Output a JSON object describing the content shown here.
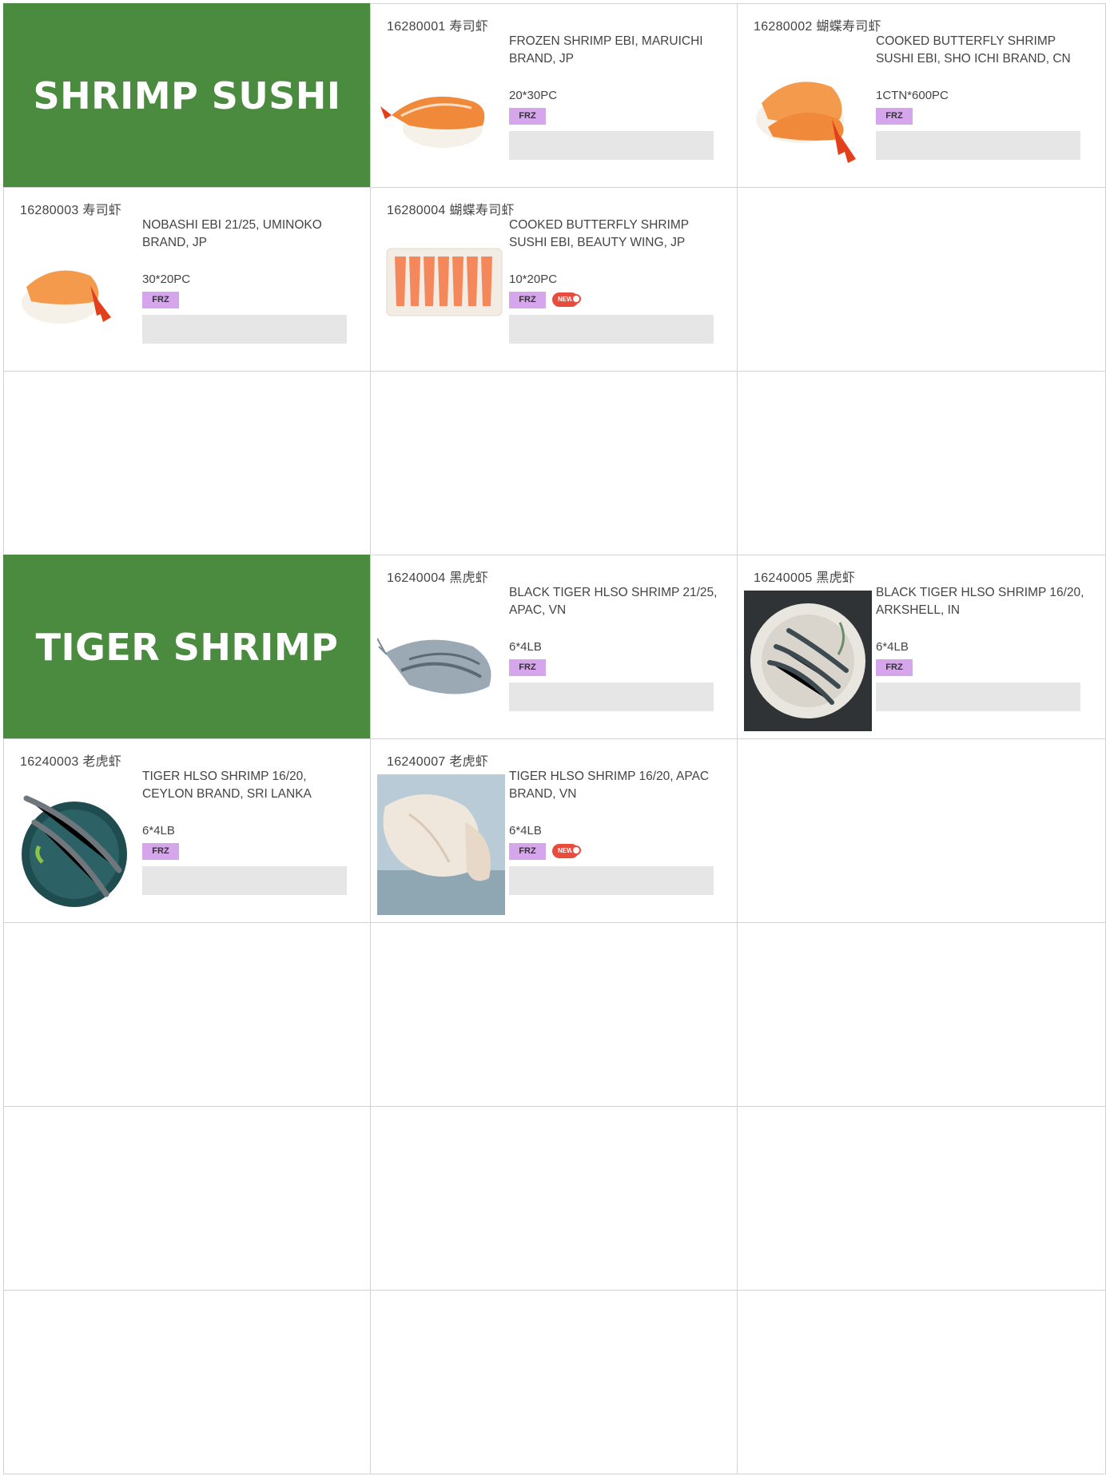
{
  "sections": [
    {
      "title": "SHRIMP SUSHI",
      "products": [
        {
          "code": "16280001 寿司虾",
          "desc": "FROZEN SHRIMP EBI, MARUICHI BRAND, JP",
          "pack": "20*30PC",
          "tag": "FRZ",
          "is_new": false,
          "new_label": ""
        },
        {
          "code": "16280002 蝴蝶寿司虾",
          "desc": "COOKED BUTTERFLY SHRIMP SUSHI EBI, SHO ICHI BRAND, CN",
          "pack": "1CTN*600PC",
          "tag": "FRZ",
          "is_new": false,
          "new_label": ""
        },
        {
          "code": "16280003 寿司虾",
          "desc": "NOBASHI EBI 21/25, UMINOKO BRAND, JP",
          "pack": "30*20PC",
          "tag": "FRZ",
          "is_new": false,
          "new_label": ""
        },
        {
          "code": "16280004 蝴蝶寿司虾",
          "desc": "COOKED BUTTERFLY SHRIMP SUSHI EBI, BEAUTY WING, JP",
          "pack": "10*20PC",
          "tag": "FRZ",
          "is_new": true,
          "new_label": "NEW"
        }
      ]
    },
    {
      "title": "TIGER SHRIMP",
      "products": [
        {
          "code": "16240004 黑虎虾",
          "desc": "BLACK TIGER HLSO SHRIMP 21/25, APAC, VN",
          "pack": "6*4LB",
          "tag": "FRZ",
          "is_new": false,
          "new_label": ""
        },
        {
          "code": "16240005 黑虎虾",
          "desc": "BLACK TIGER HLSO SHRIMP 16/20, ARKSHELL, IN",
          "pack": "6*4LB",
          "tag": "FRZ",
          "is_new": false,
          "new_label": ""
        },
        {
          "code": "16240003 老虎虾",
          "desc": "TIGER HLSO SHRIMP 16/20, CEYLON BRAND, SRI LANKA",
          "pack": "6*4LB",
          "tag": "FRZ",
          "is_new": false,
          "new_label": ""
        },
        {
          "code": "16240007 老虎虾",
          "desc": "TIGER HLSO SHRIMP 16/20, APAC BRAND, VN",
          "pack": "6*4LB",
          "tag": "FRZ",
          "is_new": true,
          "new_label": "NEW"
        }
      ]
    }
  ],
  "colors": {
    "header_bg": "#4a8b3f",
    "tag_bg": "#d5a6ec",
    "new_badge": "#e84c3d",
    "input_bg": "#e6e6e6"
  }
}
